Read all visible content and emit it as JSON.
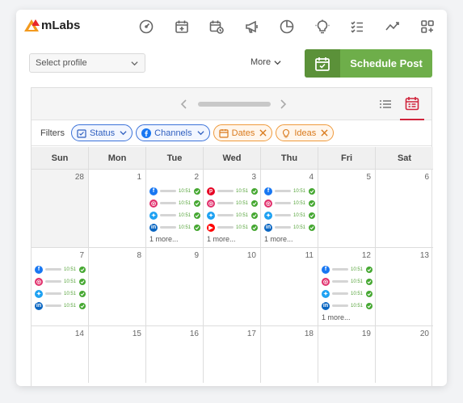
{
  "brand": {
    "name": "mLabs"
  },
  "nav_icons": [
    "dashboard-icon",
    "calendar-add-icon",
    "calendar-clock-icon",
    "megaphone-icon",
    "pie-chart-icon",
    "lightbulb-icon",
    "checklist-icon",
    "trend-line-icon",
    "grid-add-icon"
  ],
  "toolbar": {
    "select_profile_placeholder": "Select profile",
    "more_label": "More",
    "schedule_label": "Schedule Post",
    "schedule_color": "#6eae4a"
  },
  "filters": {
    "label": "Filters",
    "chips": [
      {
        "label": "Status",
        "style": "blue",
        "icon": "calendar-check-icon",
        "end": "chevron"
      },
      {
        "label": "Channels",
        "style": "blue",
        "icon": "facebook-icon",
        "end": "chevron"
      },
      {
        "label": "Dates",
        "style": "orange",
        "icon": "calendar-icon",
        "end": "close"
      },
      {
        "label": "Ideas",
        "style": "orange",
        "icon": "lightbulb-icon",
        "end": "close"
      }
    ]
  },
  "calendar": {
    "weekdays": [
      "Sun",
      "Mon",
      "Tue",
      "Wed",
      "Thu",
      "Fri",
      "Sat"
    ],
    "weeks": [
      [
        {
          "day": "28",
          "past": true
        },
        {
          "day": "1",
          "past": false
        },
        {
          "day": "2",
          "past": false,
          "posts": [
            {
              "network": "facebook",
              "time": "10:51"
            },
            {
              "network": "instagram",
              "time": "10:51"
            },
            {
              "network": "twitter",
              "time": "10:51"
            },
            {
              "network": "linkedin",
              "time": "10:51"
            }
          ],
          "more": "1 more..."
        },
        {
          "day": "3",
          "past": false,
          "posts": [
            {
              "network": "pinterest",
              "time": "10:51"
            },
            {
              "network": "instagram",
              "time": "10:51"
            },
            {
              "network": "twitter",
              "time": "10:51"
            },
            {
              "network": "youtube",
              "time": "10:51"
            }
          ],
          "more": "1 more..."
        },
        {
          "day": "4",
          "past": false,
          "posts": [
            {
              "network": "facebook",
              "time": "10:51"
            },
            {
              "network": "instagram",
              "time": "10:51"
            },
            {
              "network": "twitter",
              "time": "10:51"
            },
            {
              "network": "linkedin",
              "time": "10:51"
            }
          ],
          "more": "1 more..."
        },
        {
          "day": "5",
          "past": false
        },
        {
          "day": "6",
          "past": false
        }
      ],
      [
        {
          "day": "7",
          "past": false,
          "posts": [
            {
              "network": "facebook",
              "time": "10:51"
            },
            {
              "network": "instagram",
              "time": "10:51"
            },
            {
              "network": "twitter",
              "time": "10:51"
            },
            {
              "network": "linkedin",
              "time": "10:51"
            }
          ]
        },
        {
          "day": "8",
          "past": false
        },
        {
          "day": "9",
          "past": false
        },
        {
          "day": "10",
          "past": false
        },
        {
          "day": "11",
          "past": false
        },
        {
          "day": "12",
          "past": false,
          "posts": [
            {
              "network": "facebook",
              "time": "10:51"
            },
            {
              "network": "instagram",
              "time": "10:51"
            },
            {
              "network": "twitter",
              "time": "10:51"
            },
            {
              "network": "linkedin",
              "time": "10:51"
            }
          ],
          "more": "1 more..."
        },
        {
          "day": "13",
          "past": false
        }
      ],
      [
        {
          "day": "14",
          "past": false
        },
        {
          "day": "15",
          "past": false
        },
        {
          "day": "16",
          "past": false
        },
        {
          "day": "17",
          "past": false
        },
        {
          "day": "18",
          "past": false
        },
        {
          "day": "19",
          "past": false
        },
        {
          "day": "20",
          "past": false
        }
      ]
    ]
  },
  "network_colors": {
    "facebook": "#1877f2",
    "instagram": "#e1306c",
    "twitter": "#1da1f2",
    "linkedin": "#0a66c2",
    "pinterest": "#e60023",
    "youtube": "#ff0000"
  }
}
